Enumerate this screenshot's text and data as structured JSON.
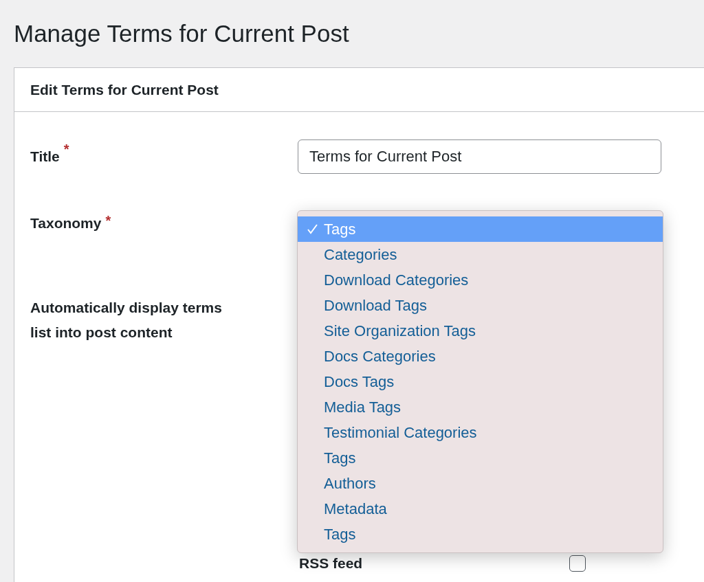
{
  "page_title": "Manage Terms for Current Post",
  "card": {
    "title": "Edit Terms for Current Post",
    "fields": [
      {
        "kind": "text",
        "label": "Title",
        "required_mark": "*",
        "value": "Terms for Current Post"
      },
      {
        "kind": "select",
        "label": "Taxonomy",
        "required_mark": "*",
        "expanded": true,
        "options": [
          {
            "label": "Tags",
            "selected": true
          },
          {
            "label": "Categories",
            "selected": false
          },
          {
            "label": "Download Categories",
            "selected": false
          },
          {
            "label": "Download Tags",
            "selected": false
          },
          {
            "label": "Site Organization Tags",
            "selected": false
          },
          {
            "label": "Docs Categories",
            "selected": false
          },
          {
            "label": "Docs Tags",
            "selected": false
          },
          {
            "label": "Media Tags",
            "selected": false
          },
          {
            "label": "Testimonial Categories",
            "selected": false
          },
          {
            "label": "Tags",
            "selected": false
          },
          {
            "label": "Authors",
            "selected": false
          },
          {
            "label": "Metadata",
            "selected": false
          },
          {
            "label": "Tags",
            "selected": false
          }
        ]
      },
      {
        "kind": "group",
        "label": "Automatically display terms list into post content",
        "options": [
          {
            "label": "RSS feed",
            "checked": false
          }
        ]
      }
    ]
  }
}
